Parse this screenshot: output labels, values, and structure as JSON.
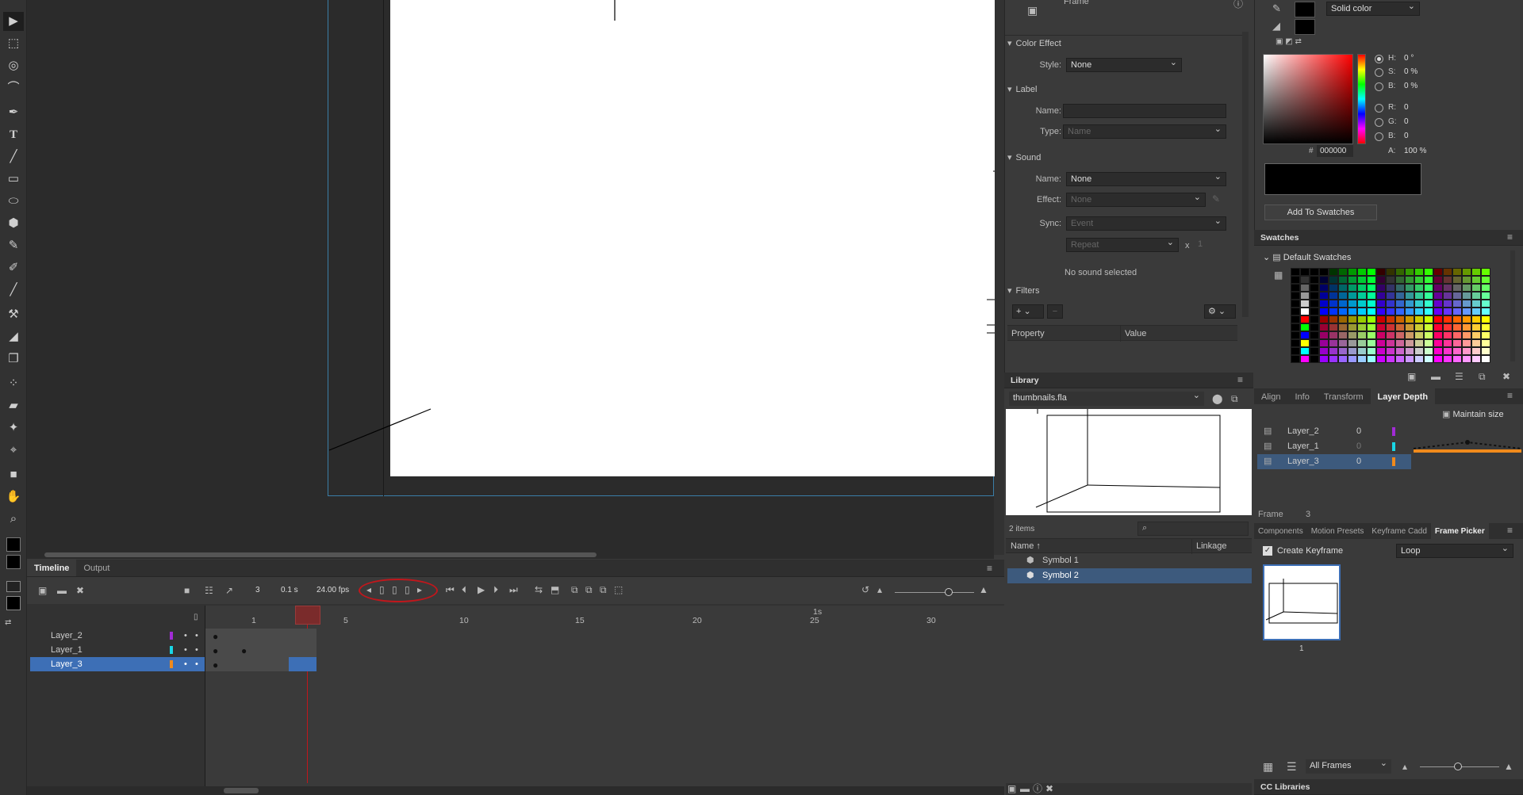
{
  "colors": {
    "accent": "#3d6fb6",
    "highlight_red": "#c0171c",
    "layer2": "#a22bd6",
    "layer1": "#19d6e6",
    "layer3": "#f08a1c"
  },
  "toolbar": {
    "tools": [
      "selection-icon",
      "free-transform-icon",
      "3d-rotation-icon",
      "lasso-icon",
      "pen-icon",
      "text-icon",
      "line-icon",
      "rectangle-icon",
      "oval-icon",
      "polystar-icon",
      "pencil-icon",
      "paint-brush-icon",
      "brush-icon",
      "bone-icon",
      "paint-bucket-icon",
      "width-tool-icon",
      "eyedropper-icon",
      "eraser-icon",
      "asset-warp-icon",
      "pin-icon",
      "camera-icon",
      "hand-icon",
      "zoom-icon"
    ]
  },
  "properties": {
    "frame_label": "Frame",
    "color_effect": {
      "title": "Color Effect",
      "style_label": "Style:",
      "style_value": "None"
    },
    "label_section": {
      "title": "Label",
      "name_label": "Name:",
      "name_value": "",
      "type_label": "Type:",
      "type_value": "Name"
    },
    "sound": {
      "title": "Sound",
      "name_label": "Name:",
      "name_value": "None",
      "effect_label": "Effect:",
      "effect_value": "None",
      "sync_label": "Sync:",
      "sync_value": "Event",
      "repeat_value": "Repeat",
      "x_label": "x",
      "repeat_count": "1",
      "status": "No sound selected"
    },
    "filters": {
      "title": "Filters",
      "col_property": "Property",
      "col_value": "Value"
    }
  },
  "library": {
    "title": "Library",
    "file": "thumbnails.fla",
    "count": "2 items",
    "col_name": "Name ↑",
    "col_linkage": "Linkage",
    "items": [
      "Symbol 1",
      "Symbol 2"
    ],
    "selected": 1
  },
  "color_panel": {
    "fill_type": "Solid color",
    "h_label": "H:",
    "h_value": "0 °",
    "s_label": "S:",
    "s_value": "0 %",
    "b_label": "B:",
    "b_value": "0 %",
    "r_label": "R:",
    "r_value": "0",
    "g_label": "G:",
    "g_value": "0",
    "b2_label": "B:",
    "b2_value": "0",
    "hex_label": "#",
    "hex_value": "000000",
    "alpha_label": "A:",
    "alpha_value": "100 %",
    "add_button": "Add To Swatches"
  },
  "swatches": {
    "title": "Swatches",
    "folder": "Default Swatches"
  },
  "layer_depth": {
    "tabs": [
      "Align",
      "Info",
      "Transform",
      "Layer Depth"
    ],
    "active": 3,
    "maintain": "Maintain size",
    "layers": [
      {
        "name": "Layer_2",
        "value": "0"
      },
      {
        "name": "Layer_1",
        "value": "0"
      },
      {
        "name": "Layer_3",
        "value": "0"
      }
    ],
    "frame_label": "Frame",
    "frame_value": "3"
  },
  "frame_picker": {
    "tabs": [
      "Components",
      "Motion Presets",
      "Keyframe Cadd",
      "Frame Picker"
    ],
    "active": 3,
    "create_keyframe": "Create Keyframe",
    "loop": "Loop",
    "thumb_label": "1",
    "filter": "All Frames"
  },
  "cc_libraries": "CC Libraries",
  "timeline": {
    "tabs": [
      "Timeline",
      "Output"
    ],
    "active": 0,
    "frame": "3",
    "time": "0.1 s",
    "fps": "24.00 fps",
    "ruler": [
      "1",
      "5",
      "10",
      "15",
      "20",
      "25",
      "30"
    ],
    "second_mark": "1s",
    "layers": [
      {
        "name": "Layer_2",
        "color": "#a22bd6"
      },
      {
        "name": "Layer_1",
        "color": "#19d6e6"
      },
      {
        "name": "Layer_3",
        "color": "#f08a1c"
      }
    ],
    "selected_layer": 2
  }
}
